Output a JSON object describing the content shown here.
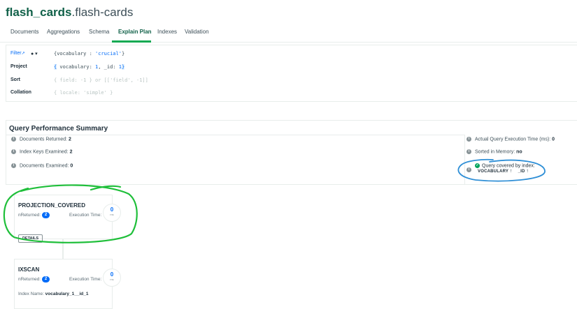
{
  "header": {
    "db": "flash_cards",
    "collection": ".flash-cards"
  },
  "tabs": [
    {
      "label": "Documents"
    },
    {
      "label": "Aggregations"
    },
    {
      "label": "Schema"
    },
    {
      "label": "Explain Plan"
    },
    {
      "label": "Indexes"
    },
    {
      "label": "Validation"
    }
  ],
  "query": {
    "filter_label": "Filter",
    "filter_link_icon": "↗",
    "clock_icon": "● ▾",
    "filter_value_prefix": "{vocabulary : ",
    "filter_value_str": "'crucial'",
    "filter_value_suffix": "}",
    "project_label": "Project",
    "project_open": "{",
    "project_mid": " vocabulary: ",
    "project_num1": "1",
    "project_sep": ", _id: ",
    "project_num2": "1",
    "project_close": "}",
    "sort_label": "Sort",
    "sort_placeholder": "{ field: -1 } or [['field', -1]]",
    "collation_label": "Collation",
    "collation_placeholder": "{ locale: 'simple' }"
  },
  "summary": {
    "title": "Query Performance Summary",
    "info_icon": "i",
    "check_icon": "✓",
    "docs_returned_label": "Documents Returned:",
    "docs_returned": "2",
    "keys_examined_label": "Index Keys Examined:",
    "keys_examined": "2",
    "docs_examined_label": "Documents Examined:",
    "docs_examined": "0",
    "exec_time_label": "Actual Query Execution Time (ms):",
    "exec_time": "0",
    "sorted_label": "Sorted in Memory:",
    "sorted": "no",
    "covered_label": "Query covered by index:",
    "index_fields": [
      {
        "name": "VOCABULARY",
        "dir": "↑"
      },
      {
        "name": "_ID",
        "dir": "↑"
      }
    ]
  },
  "stages": [
    {
      "name": "PROJECTION_COVERED",
      "nreturned_label": "nReturned:",
      "nreturned": "2",
      "exec_label": "Execution Time:",
      "exec_ms": "0",
      "ms_unit": "ms",
      "details_label": "DETAILS"
    },
    {
      "name": "IXSCAN",
      "nreturned_label": "nReturned:",
      "nreturned": "2",
      "exec_label": "Execution Time:",
      "exec_ms": "0",
      "ms_unit": "ms",
      "index_name_label": "Index Name:",
      "index_name": "vocabulary_1__id_1"
    }
  ],
  "colors": {
    "accent_green": "#13aa52",
    "link_blue": "#016bf8",
    "annotation_green": "#1fbf3a",
    "annotation_blue": "#2f8fd6"
  }
}
